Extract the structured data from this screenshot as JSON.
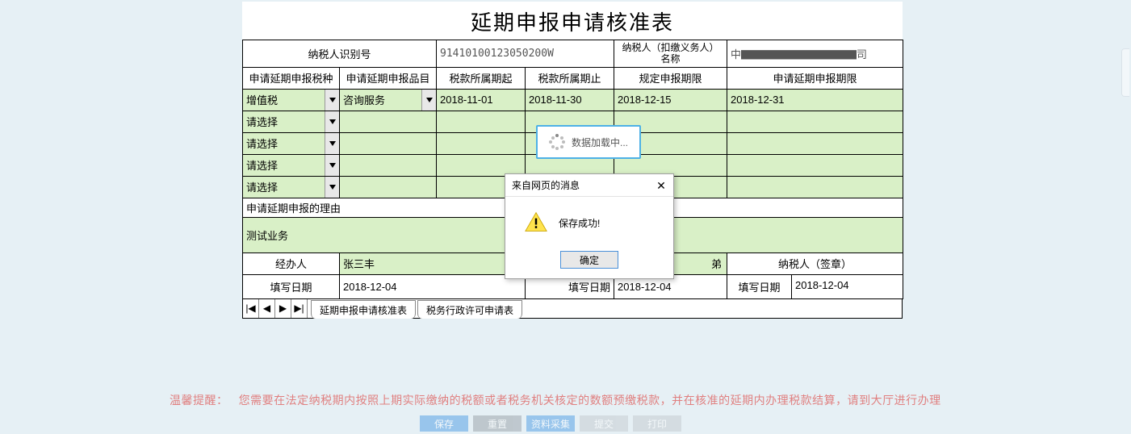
{
  "title": "延期申报申请核准表",
  "header": {
    "taxpayer_id_label": "纳税人识别号",
    "taxpayer_id": "91410100123050200W",
    "taxpayer_name_label": "纳税人（扣缴义务人）名称",
    "taxpayer_name": "中▇▇▇▇▇▇▇▇▇▇▇司"
  },
  "cols": {
    "c1": "申请延期申报税种",
    "c2": "申请延期申报品目",
    "c3": "税款所属期起",
    "c4": "税款所属期止",
    "c5": "规定申报期限",
    "c6": "申请延期申报期限"
  },
  "rows": [
    {
      "tax": "增值税",
      "item": "咨询服务",
      "from": "2018-11-01",
      "to": "2018-11-30",
      "due": "2018-12-15",
      "ext": "2018-12-31"
    },
    {
      "tax": "请选择",
      "item": "",
      "from": "",
      "to": "",
      "due": "",
      "ext": ""
    },
    {
      "tax": "请选择",
      "item": "",
      "from": "",
      "to": "",
      "due": "",
      "ext": ""
    },
    {
      "tax": "请选择",
      "item": "",
      "from": "",
      "to": "",
      "due": "",
      "ext": ""
    },
    {
      "tax": "请选择",
      "item": "",
      "from": "",
      "to": "",
      "due": "",
      "ext": ""
    }
  ],
  "reason_label": "申请延期申报的理由",
  "reason_text": "测试业务",
  "footer": {
    "handler_label": "经办人",
    "handler": "张三丰",
    "approver": "弟",
    "signer_label": "纳税人（签章）",
    "date_label": "填写日期",
    "date1": "2018-12-04",
    "date_label2": "填写日期",
    "date2": "2018-12-04",
    "date_label3": "填写日期",
    "date3": "2018-12-04"
  },
  "tabs": {
    "t1": "延期申报申请核准表",
    "t2": "税务行政许可申请表"
  },
  "nav_icons": [
    "|◀",
    "◀",
    "▶",
    "▶|"
  ],
  "tip": {
    "label": "温馨提醒：",
    "text": "您需要在法定纳税期内按照上期实际缴纳的税额或者税务机关核定的数额预缴税款，并在核准的延期内办理税款结算，请到大厅进行办理"
  },
  "buttons": [
    "保存",
    "重置",
    "资料采集",
    "提交",
    "打印"
  ],
  "loading_text": "数据加载中...",
  "dialog": {
    "title": "来自网页的消息",
    "message": "保存成功!",
    "ok": "确定"
  }
}
